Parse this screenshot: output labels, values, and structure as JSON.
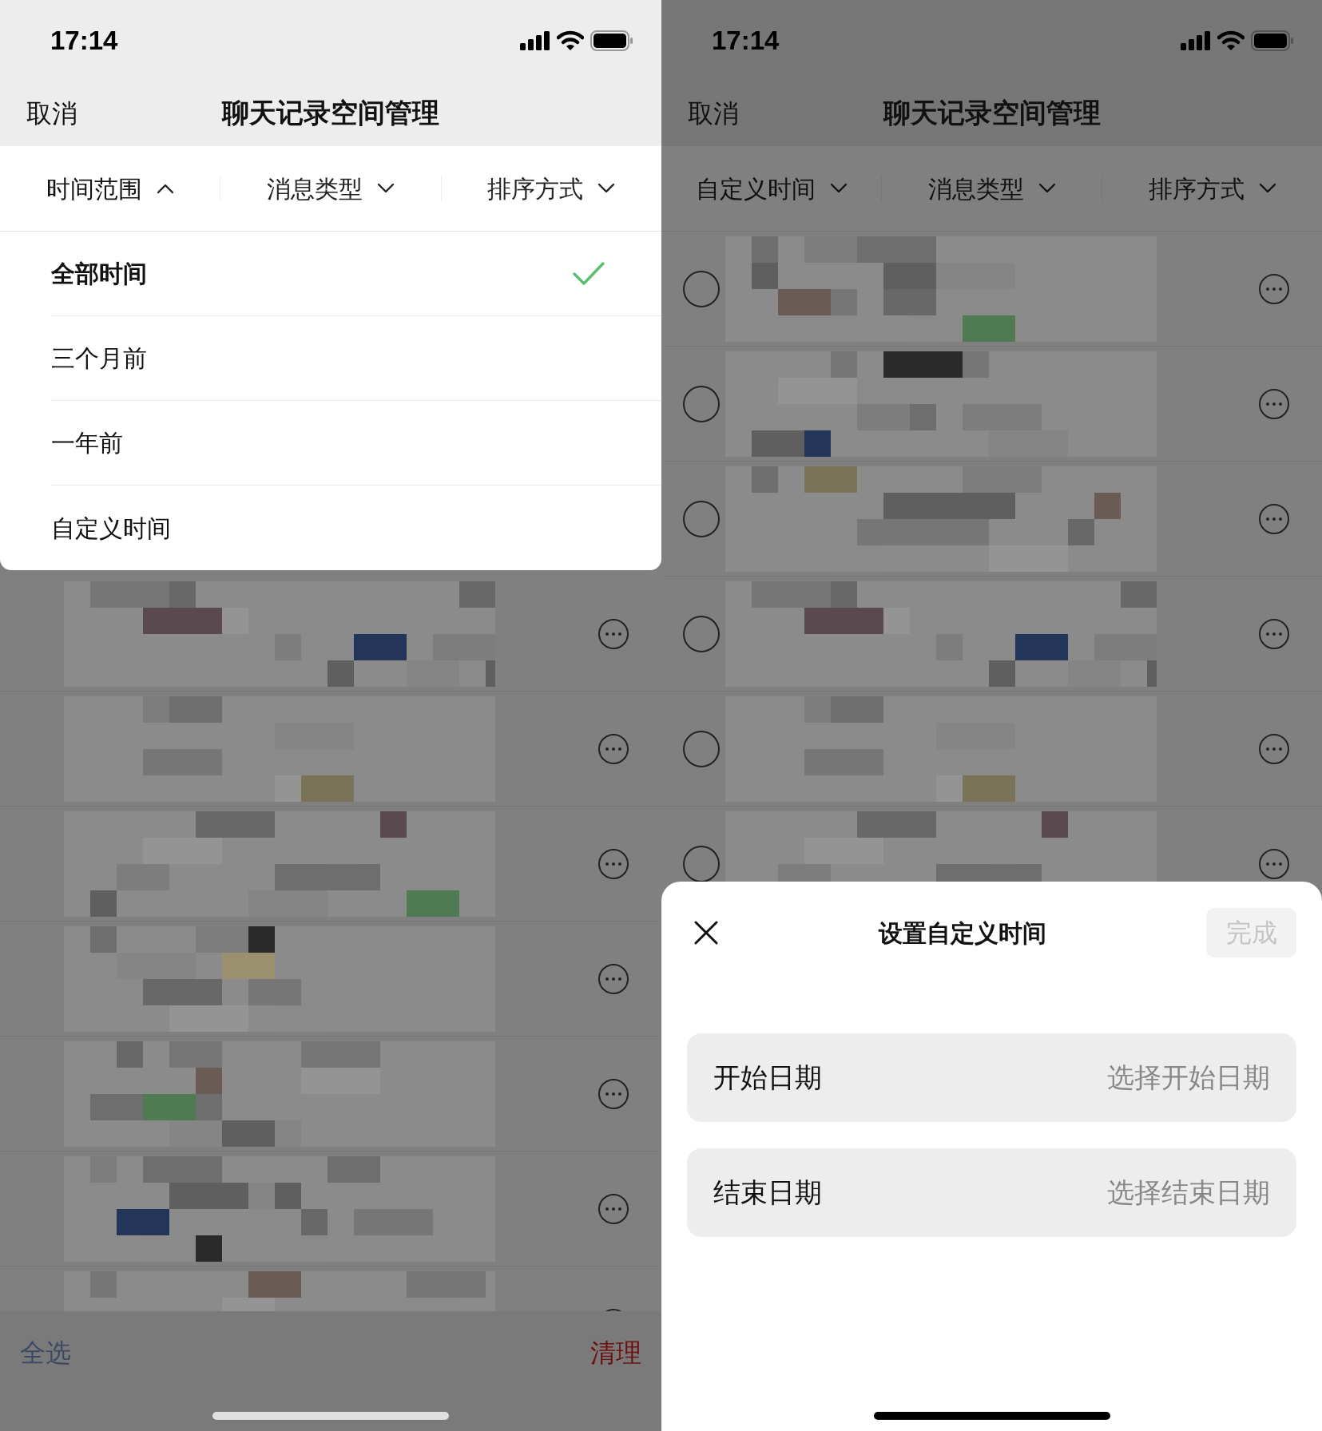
{
  "screens": [
    {
      "status_bar": {
        "time": "17:14"
      },
      "nav": {
        "cancel": "取消",
        "title": "聊天记录空间管理"
      },
      "dimmed_header": false,
      "filters": [
        {
          "label": "时间范围",
          "expanded": true
        },
        {
          "label": "消息类型",
          "expanded": false
        },
        {
          "label": "排序方式",
          "expanded": false
        }
      ],
      "dropdown": {
        "options": [
          {
            "label": "全部时间",
            "selected": true
          },
          {
            "label": "三个月前",
            "selected": false
          },
          {
            "label": "一年前",
            "selected": false
          },
          {
            "label": "自定义时间",
            "selected": false
          }
        ]
      },
      "rows": [
        {
          "kind": "picture"
        },
        {
          "kind": "picture"
        },
        {
          "kind": "picture"
        },
        {
          "kind": "picture"
        },
        {
          "kind": "picture"
        },
        {
          "kind": "picture"
        },
        {
          "kind": "picture"
        }
      ],
      "bottom_bar": {
        "select_all": "全选",
        "clean": "清理"
      }
    },
    {
      "status_bar": {
        "time": "17:14"
      },
      "nav": {
        "cancel": "取消",
        "title": "聊天记录空间管理"
      },
      "dimmed_header": true,
      "filters": [
        {
          "label": "自定义时间",
          "expanded": false
        },
        {
          "label": "消息类型",
          "expanded": false
        },
        {
          "label": "排序方式",
          "expanded": false
        }
      ],
      "rows": [
        {
          "kind": "picture",
          "checked": false
        },
        {
          "kind": "picture",
          "checked": false
        },
        {
          "kind": "picture",
          "checked": false
        },
        {
          "kind": "picture",
          "checked": false
        },
        {
          "kind": "picture",
          "checked": false
        },
        {
          "kind": "picture",
          "checked": false
        }
      ],
      "sheet": {
        "title": "设置自定义时间",
        "done": {
          "label": "完成",
          "disabled": true
        },
        "fields": [
          {
            "label": "开始日期",
            "placeholder": "选择开始日期"
          },
          {
            "label": "结束日期",
            "placeholder": "选择结束日期"
          }
        ]
      }
    }
  ]
}
